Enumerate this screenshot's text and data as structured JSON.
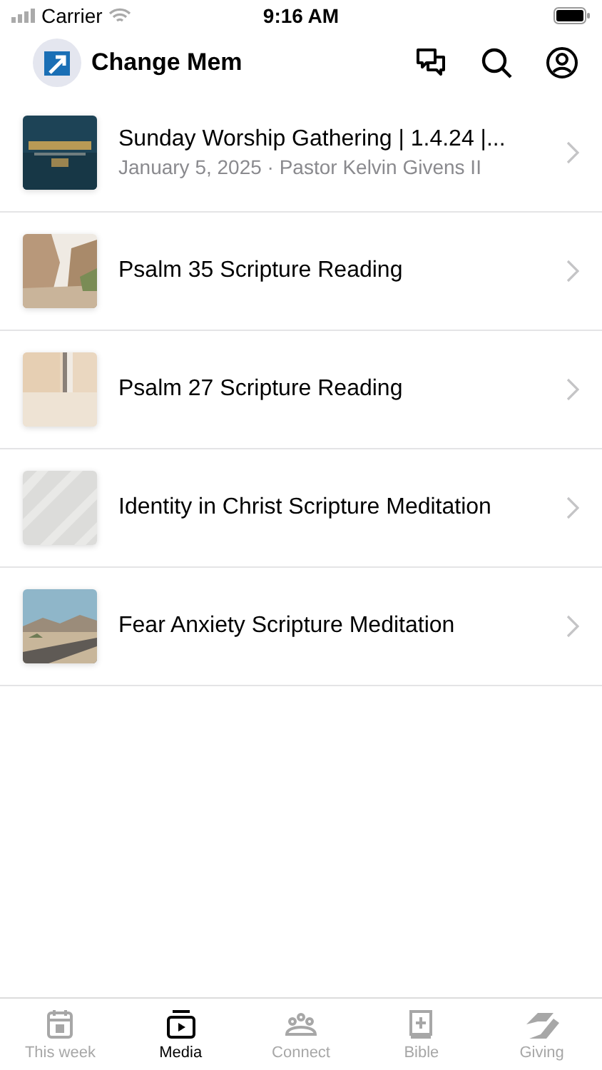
{
  "status_bar": {
    "carrier": "Carrier",
    "time": "9:16 AM"
  },
  "header": {
    "title": "Change Mem"
  },
  "items": [
    {
      "title": "Sunday Worship Gathering | 1.4.24 |...",
      "subtitle": "January 5, 2025 · Pastor Kelvin Givens II"
    },
    {
      "title": "Psalm 35 Scripture Reading"
    },
    {
      "title": "Psalm 27 Scripture Reading"
    },
    {
      "title": "Identity in Christ Scripture Meditation"
    },
    {
      "title": "Fear Anxiety Scripture Meditation"
    }
  ],
  "tab_bar": [
    {
      "kind": "calendar",
      "label": "This week",
      "selected": false
    },
    {
      "kind": "media",
      "label": "Media",
      "selected": true
    },
    {
      "kind": "people",
      "label": "Connect",
      "selected": false
    },
    {
      "kind": "book",
      "label": "Bible",
      "selected": false
    },
    {
      "kind": "hand",
      "label": "Giving",
      "selected": false
    }
  ]
}
